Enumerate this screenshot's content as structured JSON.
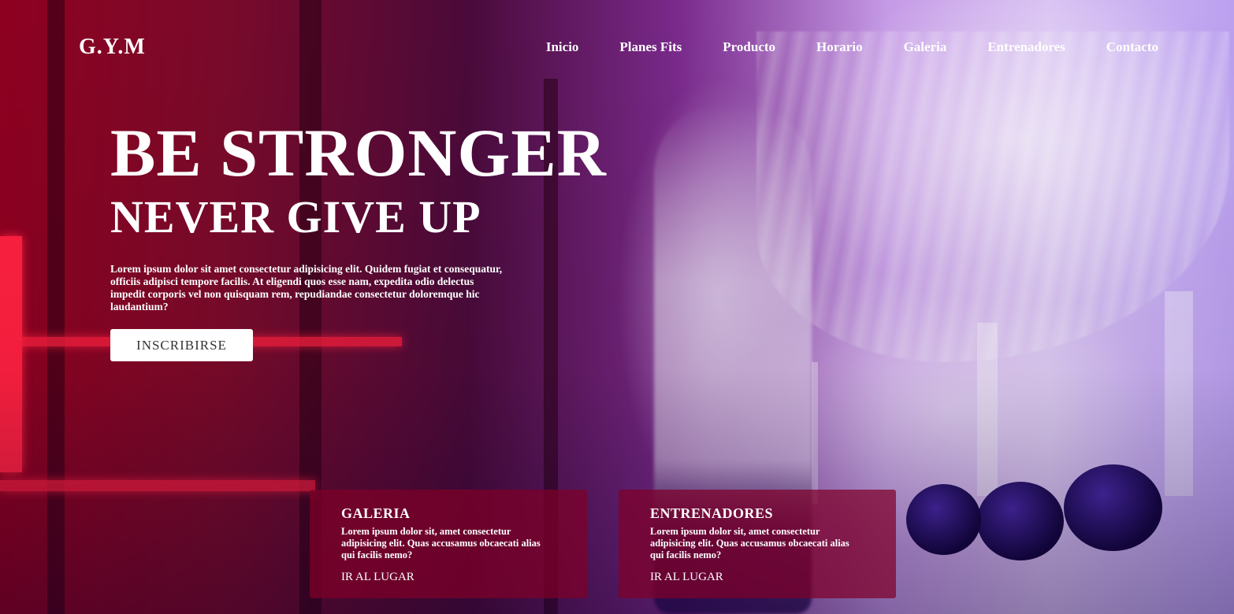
{
  "brand": {
    "logo": "G.Y.M"
  },
  "nav": {
    "items": [
      {
        "label": "Inicio"
      },
      {
        "label": "Planes Fits"
      },
      {
        "label": "Producto"
      },
      {
        "label": "Horario"
      },
      {
        "label": "Galeria"
      },
      {
        "label": "Entrenadores"
      },
      {
        "label": "Contacto"
      }
    ]
  },
  "hero": {
    "title": "BE STRONGER",
    "subtitle": "NEVER GIVE UP",
    "description": "Lorem ipsum dolor sit amet consectetur adipisicing elit. Quidem fugiat et consequatur, officiis adipisci tempore facilis. At eligendi quos esse nam, expedita odio delectus impedit corporis vel non quisquam rem, repudiandae consectetur doloremque hic laudantium?",
    "cta_label": "INSCRIBIRSE"
  },
  "cards": [
    {
      "title": "GALERIA",
      "text": "Lorem ipsum dolor sit, amet consectetur adipisicing elit. Quas accusamus obcaecati alias qui facilis nemo?",
      "link": "IR AL LUGAR"
    },
    {
      "title": "ENTRENADORES",
      "text": "Lorem ipsum dolor sit, amet consectetur adipisicing elit. Quas accusamus obcaecati alias qui facilis nemo?",
      "link": "IR AL LUGAR"
    }
  ],
  "colors": {
    "text": "#ffffff",
    "card_bg": "#800028",
    "button_bg": "#ffffff",
    "button_text": "#333333"
  }
}
